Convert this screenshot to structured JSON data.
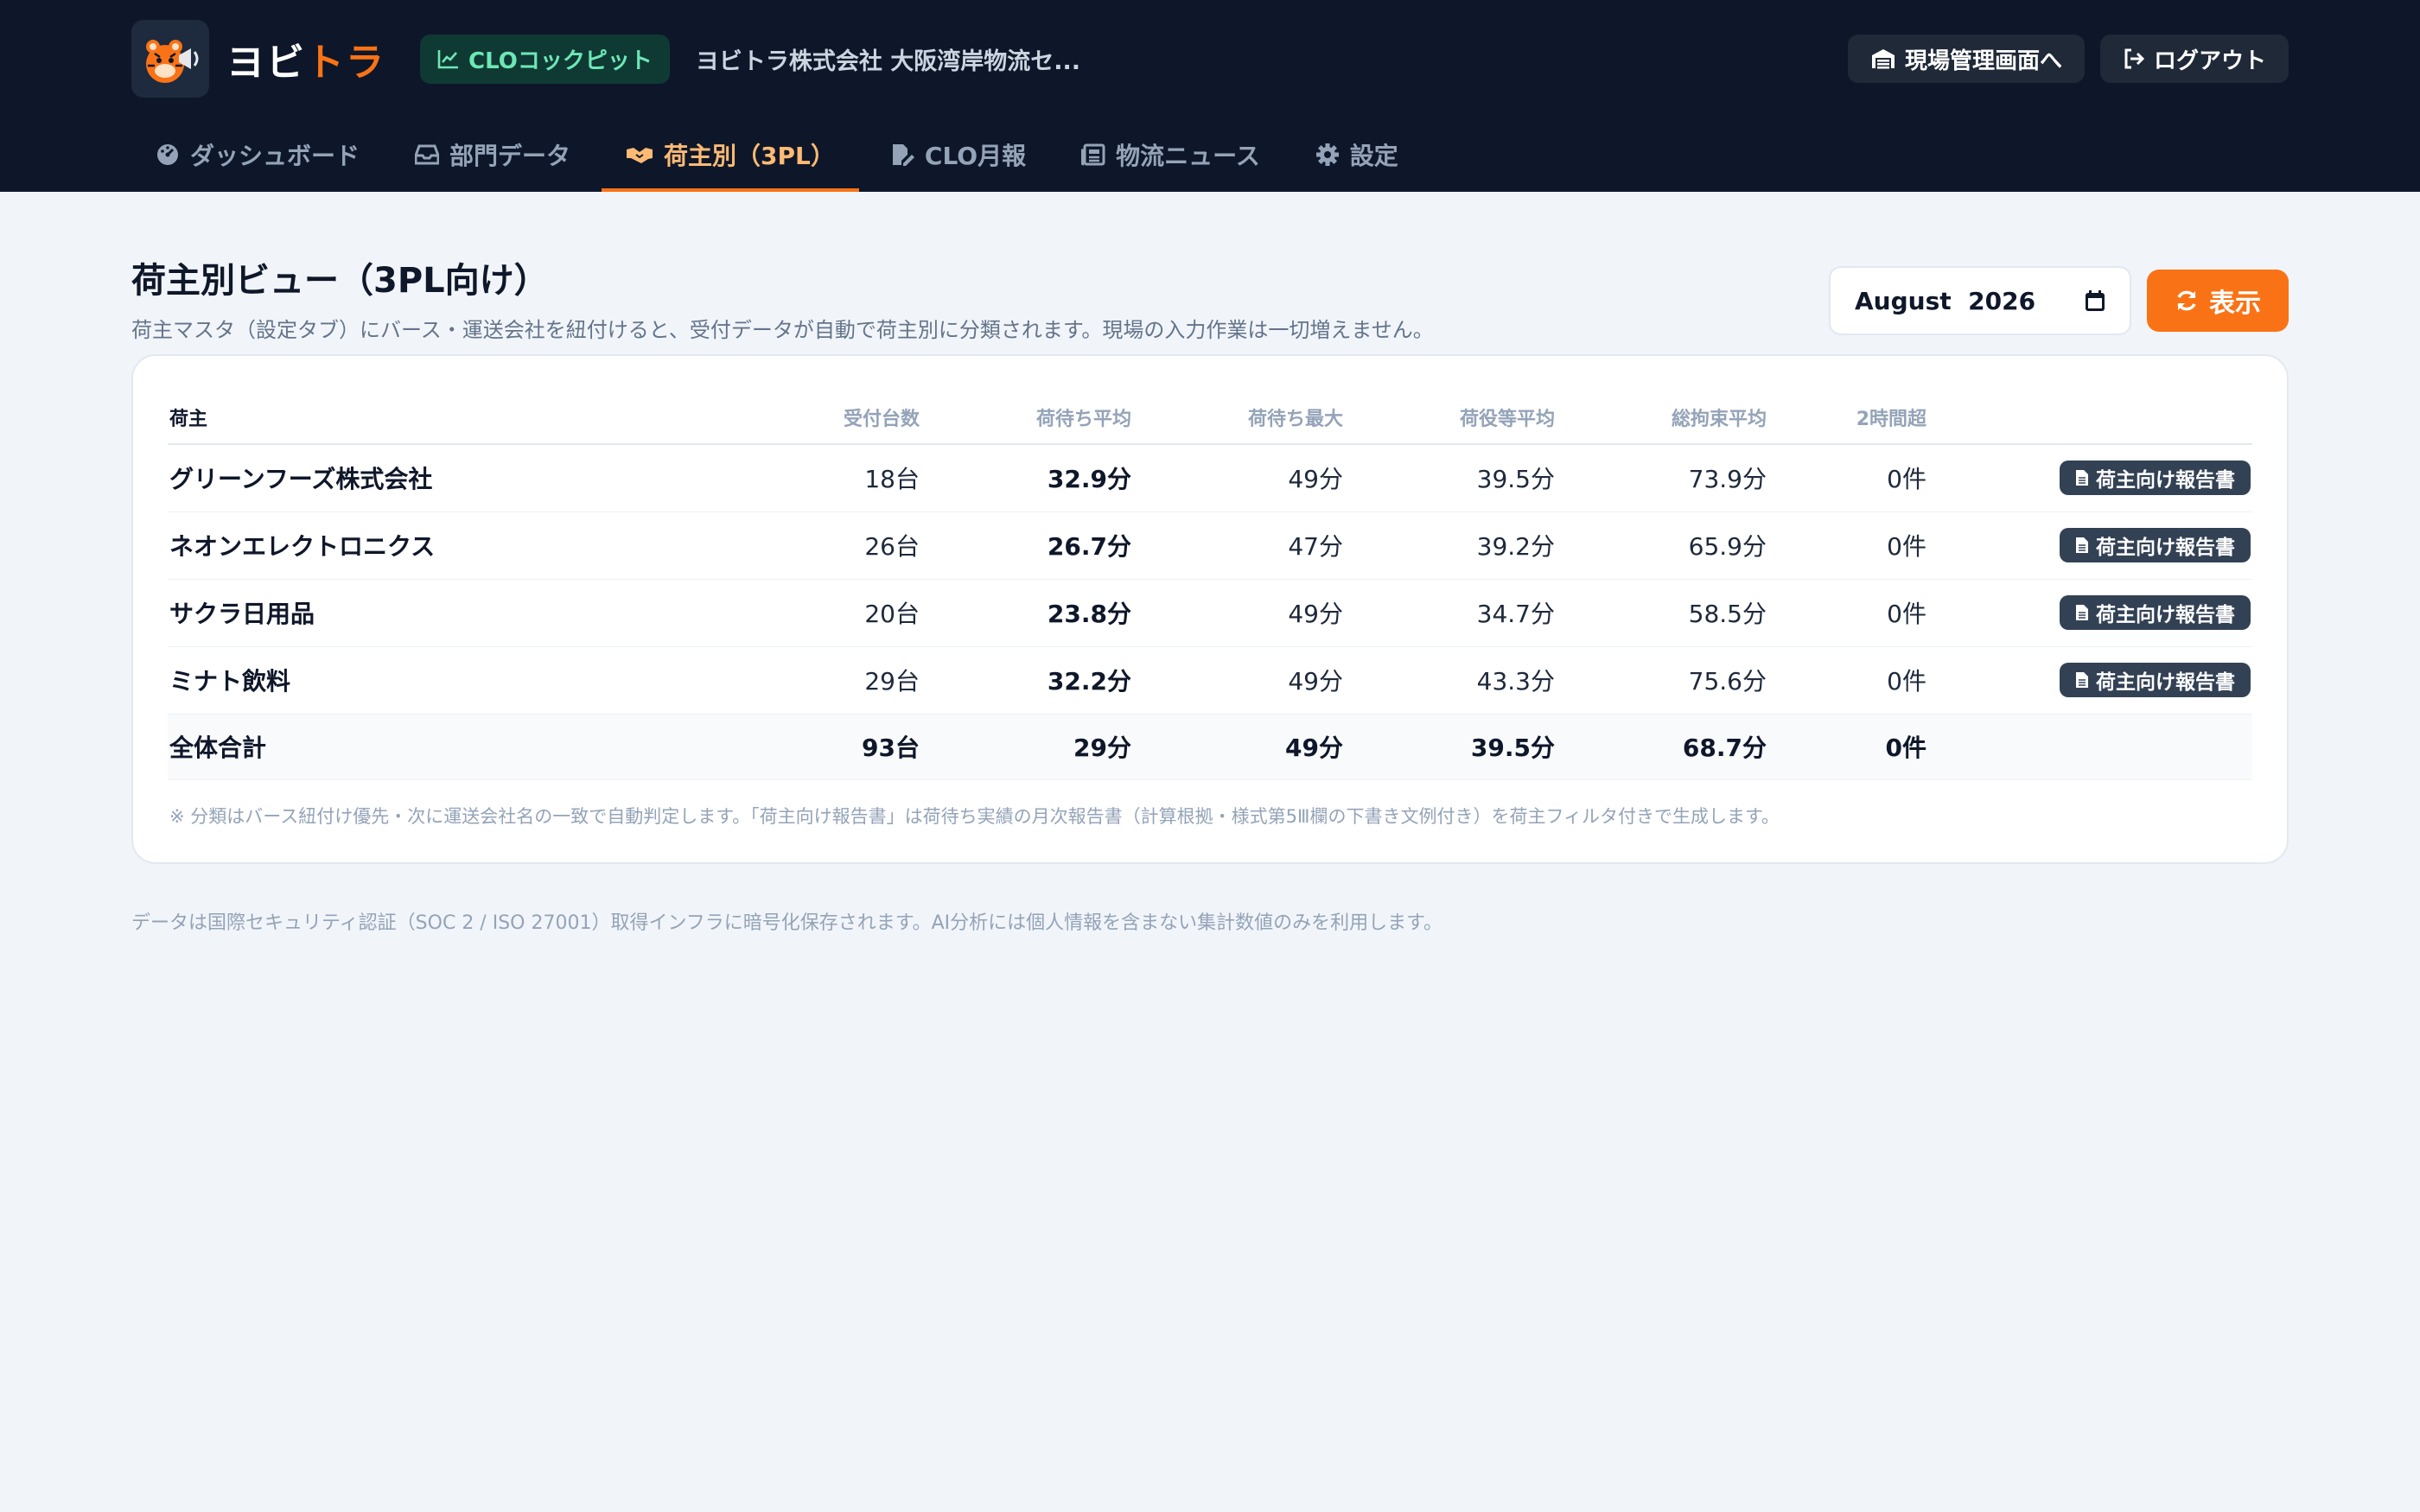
{
  "header": {
    "brand_main": "ヨビ",
    "brand_accent": "トラ",
    "badge": "CLOコックピット",
    "company": "ヨビトラ株式会社 大阪湾岸物流セ...",
    "site_button": "現場管理画面へ",
    "logout_button": "ログアウト",
    "colors": {
      "bg": "#0e1729",
      "accent": "#f97316",
      "badge_text": "#6ee7b7"
    }
  },
  "tabs": [
    {
      "label": "ダッシュボード",
      "icon": "gauge-icon"
    },
    {
      "label": "部門データ",
      "icon": "inbox-icon"
    },
    {
      "label": "荷主別（3PL）",
      "icon": "handshake-icon",
      "active": true
    },
    {
      "label": "CLO月報",
      "icon": "file-pen-icon"
    },
    {
      "label": "物流ニュース",
      "icon": "newspaper-icon"
    },
    {
      "label": "設定",
      "icon": "gear-icon"
    }
  ],
  "page": {
    "title": "荷主別ビュー（3PL向け）",
    "subtitle": "荷主マスタ（設定タブ）にバース・運送会社を紐付けると、受付データが自動で荷主別に分類されます。現場の入力作業は一切増えません。",
    "month_value": "August  2026",
    "show_button": "表示"
  },
  "table": {
    "columns": [
      "荷主",
      "受付台数",
      "荷待ち平均",
      "荷待ち最大",
      "荷役等平均",
      "総拘束平均",
      "2時間超"
    ],
    "rows": [
      {
        "name": "グリーンフーズ株式会社",
        "count": "18台",
        "wait_avg": "32.9分",
        "wait_max": "49分",
        "handling_avg": "39.5分",
        "total_avg": "73.9分",
        "over2h": "0件",
        "action": "荷主向け報告書"
      },
      {
        "name": "ネオンエレクトロニクス",
        "count": "26台",
        "wait_avg": "26.7分",
        "wait_max": "47分",
        "handling_avg": "39.2分",
        "total_avg": "65.9分",
        "over2h": "0件",
        "action": "荷主向け報告書"
      },
      {
        "name": "サクラ日用品",
        "count": "20台",
        "wait_avg": "23.8分",
        "wait_max": "49分",
        "handling_avg": "34.7分",
        "total_avg": "58.5分",
        "over2h": "0件",
        "action": "荷主向け報告書"
      },
      {
        "name": "ミナト飲料",
        "count": "29台",
        "wait_avg": "32.2分",
        "wait_max": "49分",
        "handling_avg": "43.3分",
        "total_avg": "75.6分",
        "over2h": "0件",
        "action": "荷主向け報告書"
      }
    ],
    "total": {
      "name": "全体合計",
      "count": "93台",
      "wait_avg": "29分",
      "wait_max": "49分",
      "handling_avg": "39.5分",
      "total_avg": "68.7分",
      "over2h": "0件"
    },
    "note": "※ 分類はバース紐付け優先・次に運送会社名の一致で自動判定します。「荷主向け報告書」は荷待ち実績の月次報告書（計算根拠・様式第5Ⅲ欄の下書き文例付き）を荷主フィルタ付きで生成します。"
  },
  "footer": {
    "security_note": "データは国際セキュリティ認証（SOC 2 / ISO 27001）取得インフラに暗号化保存されます。AI分析には個人情報を含まない集計数値のみを利用します。"
  }
}
